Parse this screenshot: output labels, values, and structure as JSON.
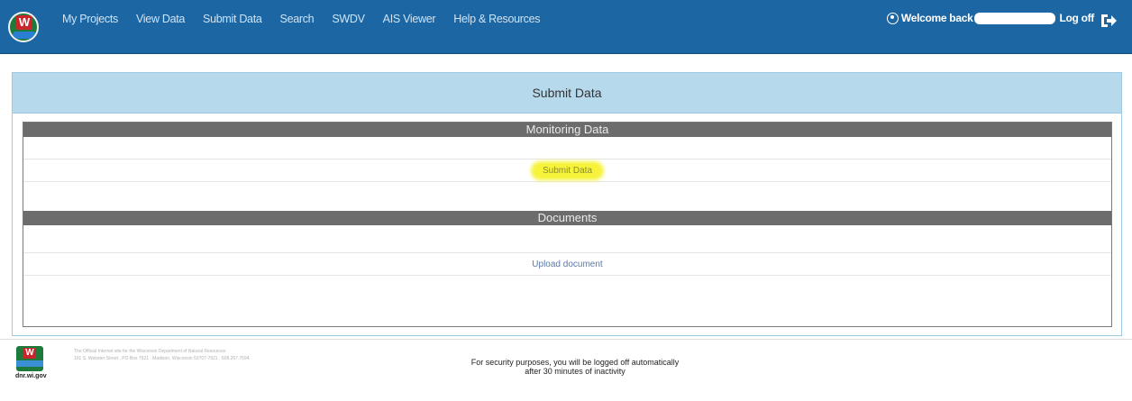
{
  "nav": {
    "links": [
      "My Projects",
      "View Data",
      "Submit Data",
      "Search",
      "SWDV",
      "AIS Viewer",
      "Help & Resources"
    ],
    "welcome": "Welcome back",
    "logoff": "Log off"
  },
  "panel": {
    "title": "Submit Data",
    "sections": [
      {
        "header": "Monitoring Data",
        "link": "Submit Data"
      },
      {
        "header": "Documents",
        "link": "Upload document"
      }
    ]
  },
  "footer": {
    "logo_caption": "dnr.wi.gov",
    "info_line1": "The Official Internet site for the Wisconsin Department of Natural Resources",
    "info_line2": "101 S. Webster Street . PO Box 7921 . Madison, Wisconsin 53707-7921 . 608.267.7694",
    "security_notice": "For security purposes, you will be logged off automatically after 30 minutes of inactivity"
  },
  "colors": {
    "navbar": "#1c67a3",
    "panel_heading": "#b7d9ec",
    "section_header": "#6c6c6c",
    "highlight": "#f6f33a"
  }
}
